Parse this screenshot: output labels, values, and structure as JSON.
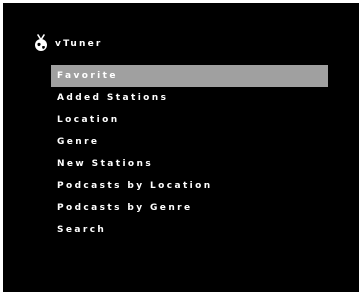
{
  "header": {
    "logo_icon": "globe-antenna-icon",
    "title": "vTuner"
  },
  "menu": {
    "selected_index": 0,
    "items": [
      {
        "label": "Favorite"
      },
      {
        "label": "Added Stations"
      },
      {
        "label": "Location"
      },
      {
        "label": "Genre"
      },
      {
        "label": "New Stations"
      },
      {
        "label": "Podcasts by Location"
      },
      {
        "label": "Podcasts by Genre"
      },
      {
        "label": "Search"
      }
    ]
  },
  "colors": {
    "background": "#000000",
    "text": "#ffffff",
    "highlight": "#a0a0a0"
  }
}
